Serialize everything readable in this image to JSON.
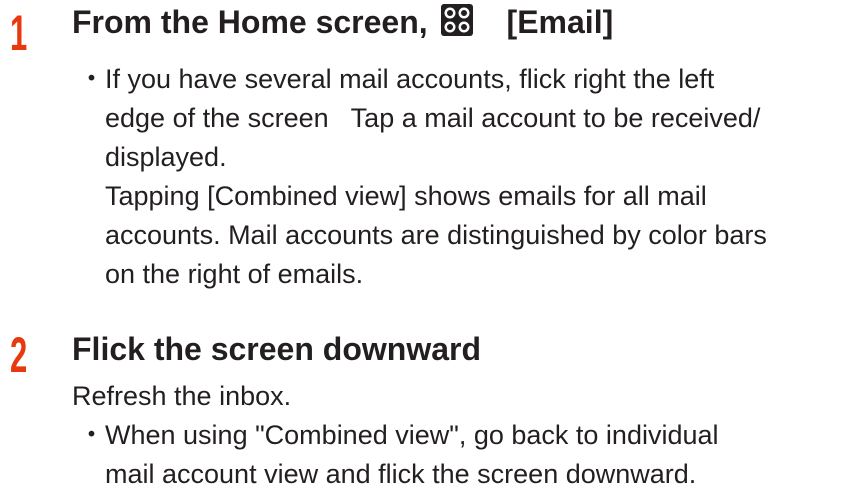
{
  "step1": {
    "number": "1",
    "title_prefix": "From the Home screen,",
    "title_icon": "apps-grid-icon",
    "title_suffix": "[Email]",
    "bullet_mark": "・",
    "bullet_lines": {
      "line1": "If you have several mail accounts, flick right the left",
      "line2a": "edge of the screen",
      "line2b": "Tap a mail account to be received/",
      "line3": "displayed.",
      "line4": "Tapping [Combined view] shows emails for all mail",
      "line5": "accounts. Mail accounts are distinguished by color bars",
      "line6": "on the right of emails."
    }
  },
  "step2": {
    "number": "2",
    "title": "Flick the screen downward",
    "body": "Refresh the inbox.",
    "bullet_mark": "・",
    "bullet_lines": {
      "line1": "When using \"Combined view\", go back to individual",
      "line2": "mail account view and flick the screen downward."
    }
  },
  "colors": {
    "step_number": "#e8380d",
    "text": "#231f20",
    "icon_fill": "#231f20"
  }
}
